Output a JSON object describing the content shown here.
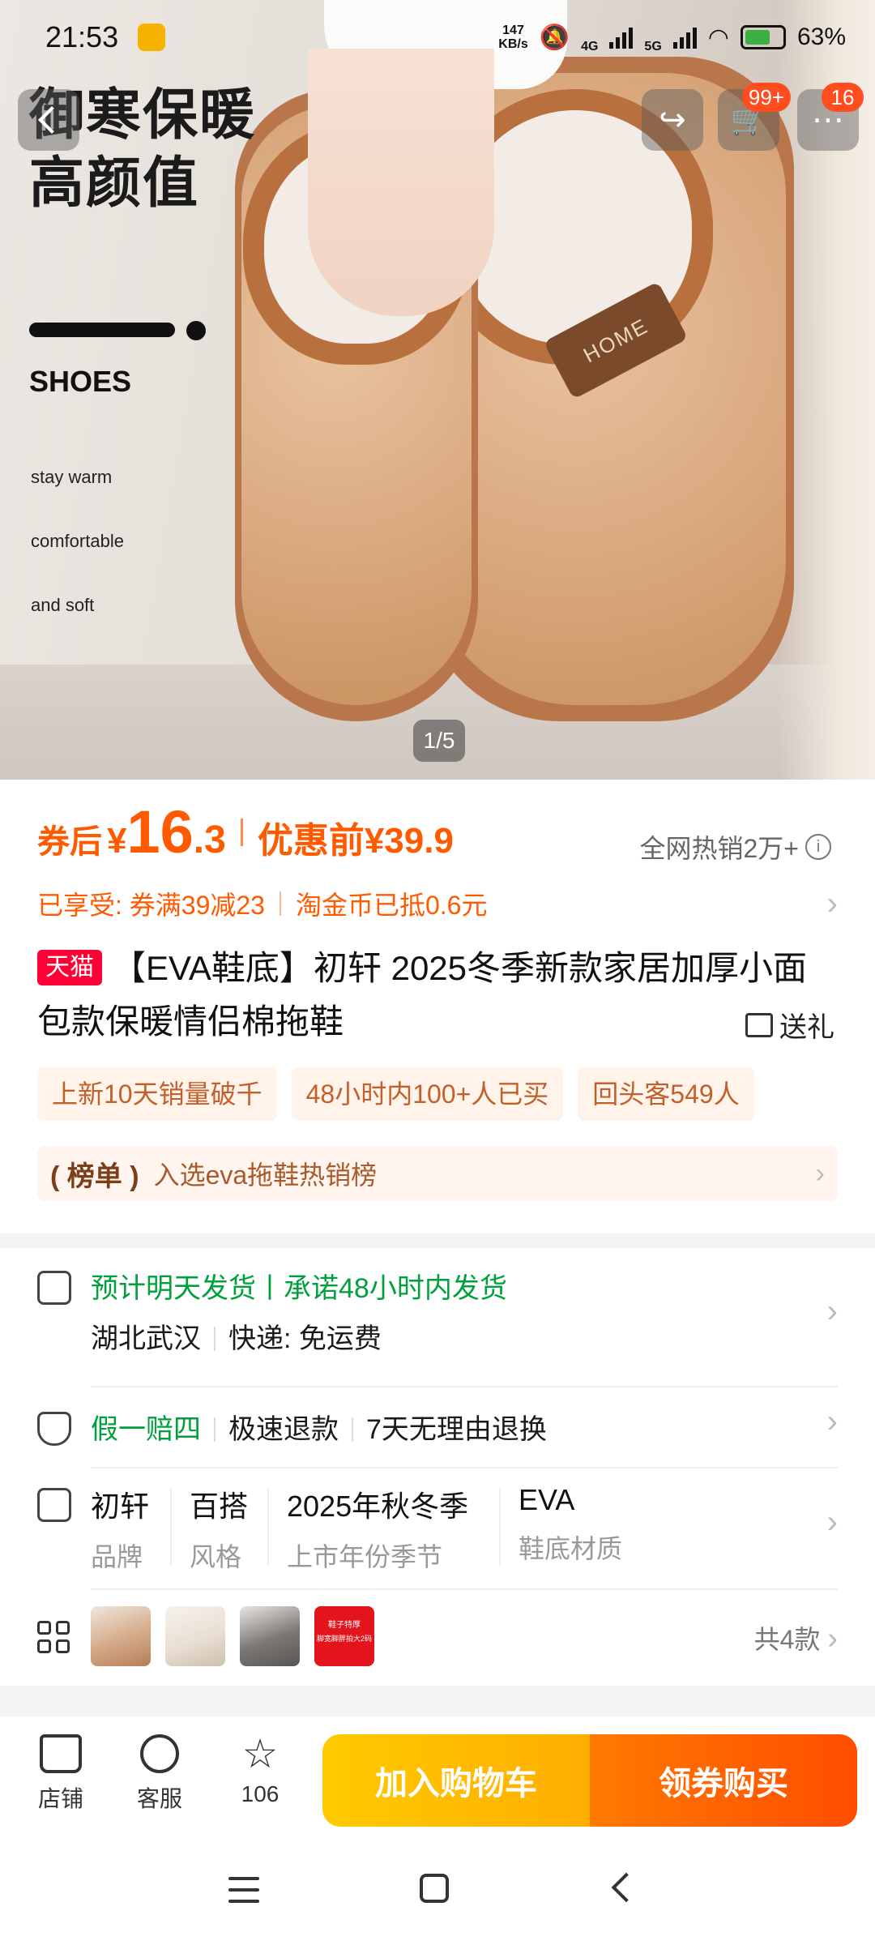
{
  "status_bar": {
    "time": "21:53",
    "net_speed_value": "147",
    "net_speed_unit": "KB/s",
    "network": "4G",
    "network2": "5G",
    "battery": "63%"
  },
  "hero": {
    "headline_line1": "御寒保暖",
    "headline_line2": "高颜值",
    "shoes_label": "SHOES",
    "features": [
      "stay warm",
      "comfortable",
      "and soft"
    ],
    "tag_text": "HOME",
    "pager": "1/5"
  },
  "top_actions": {
    "cart_badge": "99+",
    "message_badge": "16"
  },
  "price": {
    "after_coupon_label": "券后",
    "currency": "¥",
    "price_integer": "16",
    "price_decimal": ".3",
    "before_discount": "优惠前¥39.9",
    "hot_sales": "全网热销2万+",
    "promo_1": "已享受: 券满39减23",
    "promo_2": "淘金币已抵0.6元"
  },
  "product": {
    "store_badge": "天猫",
    "title": "【EVA鞋底】初轩 2025冬季新款家居加厚小面包款保暖情侣棉拖鞋",
    "gift_label": "送礼",
    "tags": [
      "上新10天销量破千",
      "48小时内100+人已买",
      "回头客549人"
    ],
    "rank_badge": "榜单",
    "rank_text": "入选eva拖鞋热销榜"
  },
  "shipping": {
    "promise": "预计明天发货丨承诺48小时内发货",
    "origin": "湖北武汉",
    "express": "快递: 免运费",
    "guarantee_1": "假一赔四",
    "guarantee_2": "极速退款",
    "guarantee_3": "7天无理由退换"
  },
  "attributes": [
    {
      "value": "初轩",
      "key": "品牌"
    },
    {
      "value": "百搭",
      "key": "风格"
    },
    {
      "value": "2025年秋冬季",
      "key": "上市年份季节"
    },
    {
      "value": "EVA",
      "key": "鞋底材质"
    }
  ],
  "variants": {
    "count_label": "共4款",
    "swatch_colors": [
      "#c99b7a",
      "#e9dfd3",
      "#6f6b69",
      "#e3141b"
    ],
    "swatch4_text_line1": "鞋子特厚",
    "swatch4_text_line2": "脚宽脚胖拍大2码"
  },
  "bottom_bar": {
    "store_label": "店铺",
    "service_label": "客服",
    "favorites_count": "106",
    "add_to_cart": "加入购物车",
    "buy_with_coupon": "领券购买"
  },
  "colors": {
    "accent_orange": "#ff5a00",
    "green": "#00a03c",
    "tmall_red": "#ff0036"
  }
}
